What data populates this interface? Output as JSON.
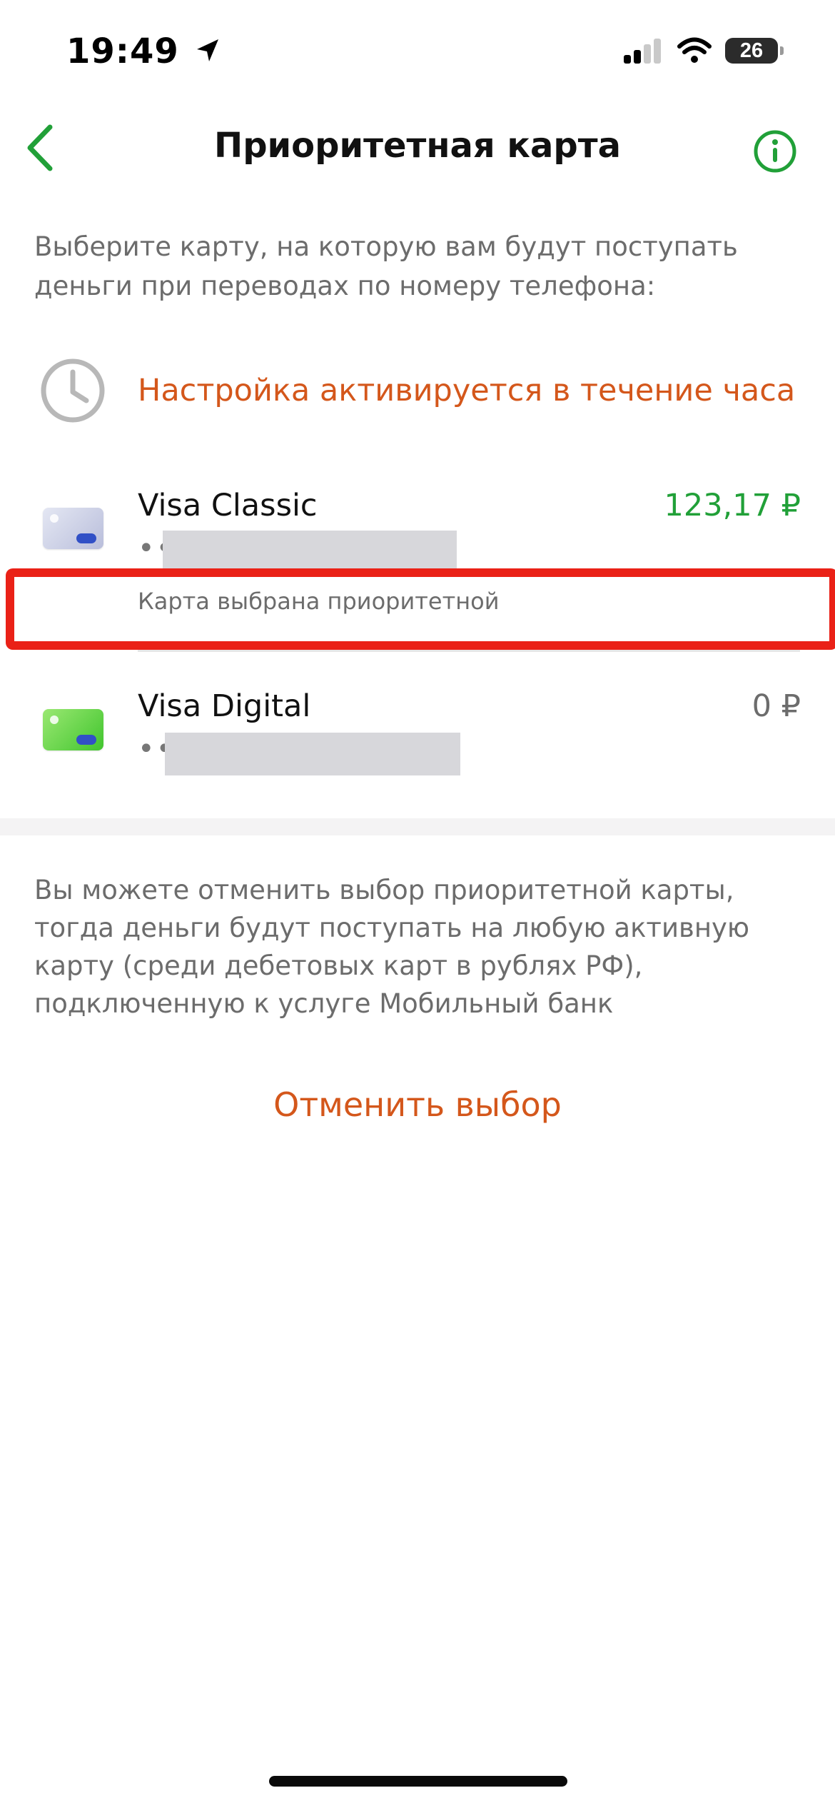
{
  "status_bar": {
    "time": "19:49",
    "battery": "26"
  },
  "header": {
    "title": "Приоритетная карта"
  },
  "intro_text": "Выберите карту, на которую вам будут поступать деньги при переводах по номеру телефона:",
  "pending_notice": "Настройка активируется в течение часа",
  "cards": [
    {
      "name": "Visa Classic",
      "number": "••",
      "balance": "123,17 ₽",
      "status": "Карта выбрана приоритетной"
    },
    {
      "name": "Visa Digital",
      "number": "••",
      "balance": "0 ₽"
    }
  ],
  "footer_note": "Вы можете отменить выбор приоритетной карты, тогда деньги будут поступать на любую активную карту (среди дебетовых карт в рублях РФ), подключенную к услуге Мобильный банк",
  "cancel_label": "Отменить выбор",
  "colors": {
    "accent_green": "#21a038",
    "accent_orange": "#d4571b",
    "highlight_red": "#ea2117"
  }
}
